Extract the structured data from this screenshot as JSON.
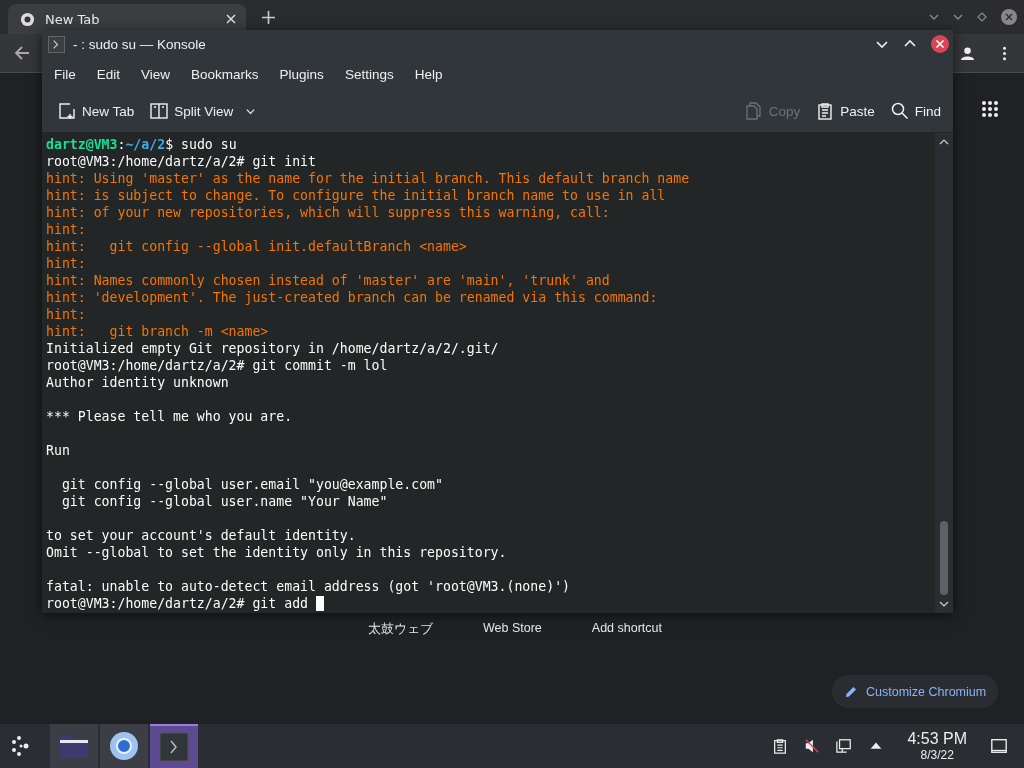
{
  "browser": {
    "tab": {
      "title": "New Tab",
      "selected": true
    },
    "shortcuts": [
      {
        "label": "太鼓ウェブ"
      },
      {
        "label": "Web Store"
      },
      {
        "label": "Add shortcut"
      }
    ],
    "customize_button": "Customize Chromium"
  },
  "konsole": {
    "title": "- : sudo su — Konsole",
    "menu": [
      "File",
      "Edit",
      "View",
      "Bookmarks",
      "Plugins",
      "Settings",
      "Help"
    ],
    "toolbar": [
      {
        "kind": "new_tab",
        "label": "New Tab",
        "disabled": false
      },
      {
        "kind": "split_view",
        "label": "Split View",
        "disabled": false
      },
      {
        "kind": "copy",
        "label": "Copy",
        "disabled": true
      },
      {
        "kind": "paste",
        "label": "Paste",
        "disabled": false
      },
      {
        "kind": "find",
        "label": "Find",
        "disabled": false
      }
    ],
    "lines": [
      {
        "kind": "user_prompt",
        "user": "dartz@VM3",
        "sep": ":",
        "path": "~/a/2",
        "command": "$ sudo su"
      },
      {
        "kind": "output",
        "text": "root@VM3:/home/dartz/a/2# git init"
      },
      {
        "kind": "hint",
        "text": "hint: Using 'master' as the name for the initial branch. This default branch name"
      },
      {
        "kind": "hint",
        "text": "hint: is subject to change. To configure the initial branch name to use in all"
      },
      {
        "kind": "hint",
        "text": "hint: of your new repositories, which will suppress this warning, call:"
      },
      {
        "kind": "hint",
        "text": "hint:"
      },
      {
        "kind": "hint",
        "text": "hint:   git config --global init.defaultBranch <name>"
      },
      {
        "kind": "hint",
        "text": "hint:"
      },
      {
        "kind": "hint",
        "text": "hint: Names commonly chosen instead of 'master' are 'main', 'trunk' and"
      },
      {
        "kind": "hint",
        "text": "hint: 'development'. The just-created branch can be renamed via this command:"
      },
      {
        "kind": "hint",
        "text": "hint:"
      },
      {
        "kind": "hint",
        "text": "hint:   git branch -m <name>"
      },
      {
        "kind": "output",
        "text": "Initialized empty Git repository in /home/dartz/a/2/.git/"
      },
      {
        "kind": "output",
        "text": "root@VM3:/home/dartz/a/2# git commit -m lol"
      },
      {
        "kind": "output",
        "text": "Author identity unknown"
      },
      {
        "kind": "blank"
      },
      {
        "kind": "output",
        "text": "*** Please tell me who you are."
      },
      {
        "kind": "blank"
      },
      {
        "kind": "output",
        "text": "Run"
      },
      {
        "kind": "blank"
      },
      {
        "kind": "output",
        "text": "  git config --global user.email \"you@example.com\""
      },
      {
        "kind": "output",
        "text": "  git config --global user.name \"Your Name\""
      },
      {
        "kind": "blank"
      },
      {
        "kind": "output",
        "text": "to set your account's default identity."
      },
      {
        "kind": "output",
        "text": "Omit --global to set the identity only in this repository."
      },
      {
        "kind": "blank"
      },
      {
        "kind": "output",
        "text": "fatal: unable to auto-detect email address (got 'root@VM3.(none)')"
      },
      {
        "kind": "output",
        "text": "root@VM3:/home/dartz/a/2# git add",
        "cursor": true
      }
    ]
  },
  "taskbar": {
    "apps": [
      {
        "kind": "files",
        "selected": false
      },
      {
        "kind": "browser",
        "selected": false
      },
      {
        "kind": "terminal",
        "selected": true
      }
    ],
    "time": "4:53 PM",
    "date": "8/3/22"
  }
}
